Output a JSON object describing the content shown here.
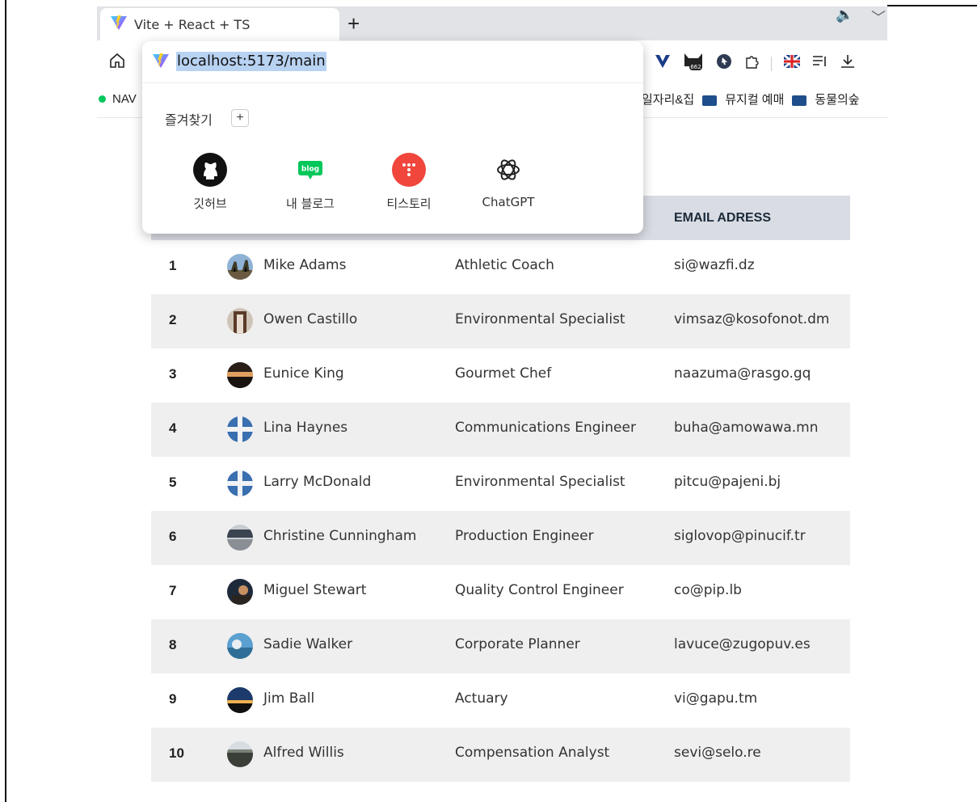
{
  "browser": {
    "tab_title": "Vite + React + TS",
    "new_tab_label": "+",
    "address": "localhost:5173/main",
    "bookmarks_left": "NAV",
    "bookmarks_right": [
      {
        "label": "일자리&집",
        "type": "text"
      },
      {
        "label": "뮤지컬 예매",
        "type": "folder"
      },
      {
        "label": "동물의숲",
        "type": "folder"
      }
    ],
    "extension_icons": [
      "vivaldi-icon",
      "cat-extension-icon",
      "cursor-icon",
      "puzzle-icon",
      "flag-icon",
      "reading-list-icon",
      "download-icon"
    ],
    "ext_badge": "662"
  },
  "favorites": {
    "label": "즐겨찾기",
    "add_label": "+",
    "items": [
      {
        "name": "깃허브",
        "icon": "github-icon"
      },
      {
        "name": "내 블로그",
        "icon": "blog-icon",
        "badge": "blog"
      },
      {
        "name": "티스토리",
        "icon": "tistory-icon"
      },
      {
        "name": "ChatGPT",
        "icon": "chatgpt-icon"
      }
    ]
  },
  "table": {
    "header_email": "EMAIL ADRESS",
    "rows": [
      {
        "id": "1",
        "name": "Mike Adams",
        "job": "Athletic Coach",
        "email": "si@wazfi.dz"
      },
      {
        "id": "2",
        "name": "Owen Castillo",
        "job": "Environmental Specialist",
        "email": "vimsaz@kosofonot.dm"
      },
      {
        "id": "3",
        "name": "Eunice King",
        "job": "Gourmet Chef",
        "email": "naazuma@rasgo.gq"
      },
      {
        "id": "4",
        "name": "Lina Haynes",
        "job": "Communications Engineer",
        "email": "buha@amowawa.mn"
      },
      {
        "id": "5",
        "name": "Larry McDonald",
        "job": "Environmental Specialist",
        "email": "pitcu@pajeni.bj"
      },
      {
        "id": "6",
        "name": "Christine Cunningham",
        "job": "Production Engineer",
        "email": "siglovop@pinucif.tr"
      },
      {
        "id": "7",
        "name": "Miguel Stewart",
        "job": "Quality Control Engineer",
        "email": "co@pip.lb"
      },
      {
        "id": "8",
        "name": "Sadie Walker",
        "job": "Corporate Planner",
        "email": "lavuce@zugopuv.es"
      },
      {
        "id": "9",
        "name": "Jim Ball",
        "job": "Actuary",
        "email": "vi@gapu.tm"
      },
      {
        "id": "10",
        "name": "Alfred Willis",
        "job": "Compensation Analyst",
        "email": "sevi@selo.re"
      }
    ]
  },
  "colors": {
    "header_bg": "#d9dce3",
    "row_alt_bg": "#efefef",
    "address_highlight": "#b8d2f2",
    "tistory_red": "#f0463c",
    "blog_green": "#03c75a"
  }
}
